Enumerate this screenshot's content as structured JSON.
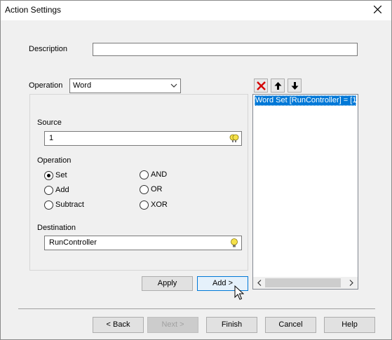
{
  "window": {
    "title": "Action Settings",
    "close_icon": "close-icon"
  },
  "form": {
    "description_label": "Description",
    "description_value": "",
    "operation_label": "Operation",
    "operation_selected": "Word"
  },
  "group": {
    "source_label": "Source",
    "source_value": "1",
    "operation_label": "Operation",
    "radios": {
      "set": "Set",
      "add": "Add",
      "subtract": "Subtract",
      "and": "AND",
      "or": "OR",
      "xor": "XOR"
    },
    "selected_radio": "Set",
    "destination_label": "Destination",
    "destination_value": "RunController"
  },
  "buttons": {
    "apply": "Apply",
    "add": "Add >",
    "back": "< Back",
    "next": "Next >",
    "finish": "Finish",
    "cancel": "Cancel",
    "help": "Help"
  },
  "list": {
    "items": [
      "Word Set [RunController] = [1"
    ],
    "toolbar_icons": [
      "delete-icon",
      "move-up-icon",
      "move-down-icon"
    ]
  },
  "colors": {
    "selection": "#0078d7",
    "delete_red": "#d40000",
    "bulb_yellow": "#f5e14a"
  }
}
